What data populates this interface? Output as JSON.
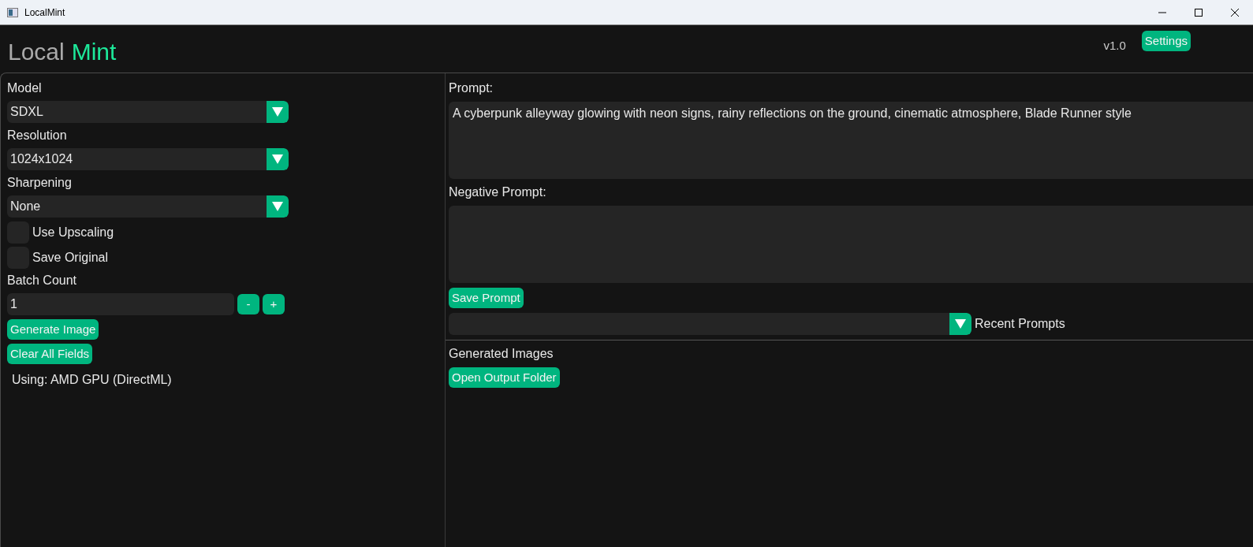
{
  "window": {
    "title": "LocalMint"
  },
  "header": {
    "brand_first": "Local",
    "brand_second": "Mint",
    "version": "v1.0",
    "settings_button": "Settings"
  },
  "left_panel": {
    "fields": [
      {
        "kind": "dropdown",
        "label": "Model",
        "value": "SDXL"
      },
      {
        "kind": "dropdown",
        "label": "Resolution",
        "value": "1024x1024"
      },
      {
        "kind": "dropdown",
        "label": "Sharpening",
        "value": "None"
      },
      {
        "kind": "checkbox",
        "label": "Use Upscaling",
        "checked": false
      },
      {
        "kind": "checkbox",
        "label": "Save Original",
        "checked": false
      },
      {
        "kind": "stepper",
        "label": "Batch Count",
        "value": "1",
        "decrement": "-",
        "increment": "+"
      }
    ],
    "buttons": [
      "Generate Image",
      "Clear All Fields"
    ],
    "status": "Using: AMD GPU (DirectML)"
  },
  "right_panel": {
    "prompt_label": "Prompt:",
    "prompt": "A cyberpunk alleyway glowing with neon signs, rainy reflections on the ground, cinematic atmosphere, Blade Runner style",
    "negative_prompt_label": "Negative Prompt:",
    "save_prompt_button": "Save Prompt",
    "recent_prompts_label": "Recent Prompts",
    "generated_images_label": "Generated Images",
    "open_output_button": "Open Output Folder"
  }
}
